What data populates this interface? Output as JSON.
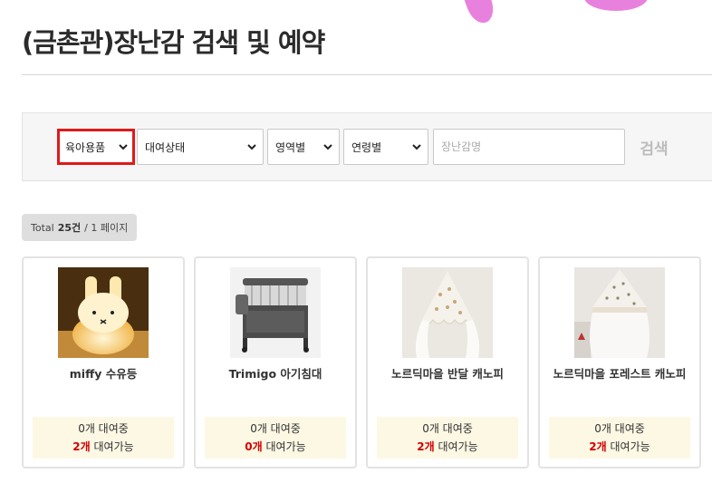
{
  "page": {
    "title": "(금촌관)장난감 검색 및 예약"
  },
  "search": {
    "category": "육아용품",
    "rental_status": "대여상태",
    "area": "영역별",
    "age": "연령별",
    "name_placeholder": "장난감명",
    "search_label": "검색"
  },
  "summary": {
    "total_prefix": "Total",
    "count": "25건",
    "pages": "/ 1 페이지"
  },
  "products": [
    {
      "name": "miffy 수유등",
      "renting": "0개 대여중",
      "available_count": "2개",
      "available_label": "대여가능"
    },
    {
      "name": "Trimigo 아기침대",
      "renting": "0개 대여중",
      "available_count": "0개",
      "available_label": "대여가능"
    },
    {
      "name": "노르딕마을 반달 캐노피",
      "renting": "0개 대여중",
      "available_count": "2개",
      "available_label": "대여가능"
    },
    {
      "name": "노르딕마을 포레스트 캐노피",
      "renting": "0개 대여중",
      "available_count": "2개",
      "available_label": "대여가능"
    }
  ],
  "colors": {
    "highlight": "#e01919",
    "available": "#d40000",
    "status_bg": "#fdf8e4"
  },
  "icons": {
    "dropdown": "chevron-down-icon"
  }
}
